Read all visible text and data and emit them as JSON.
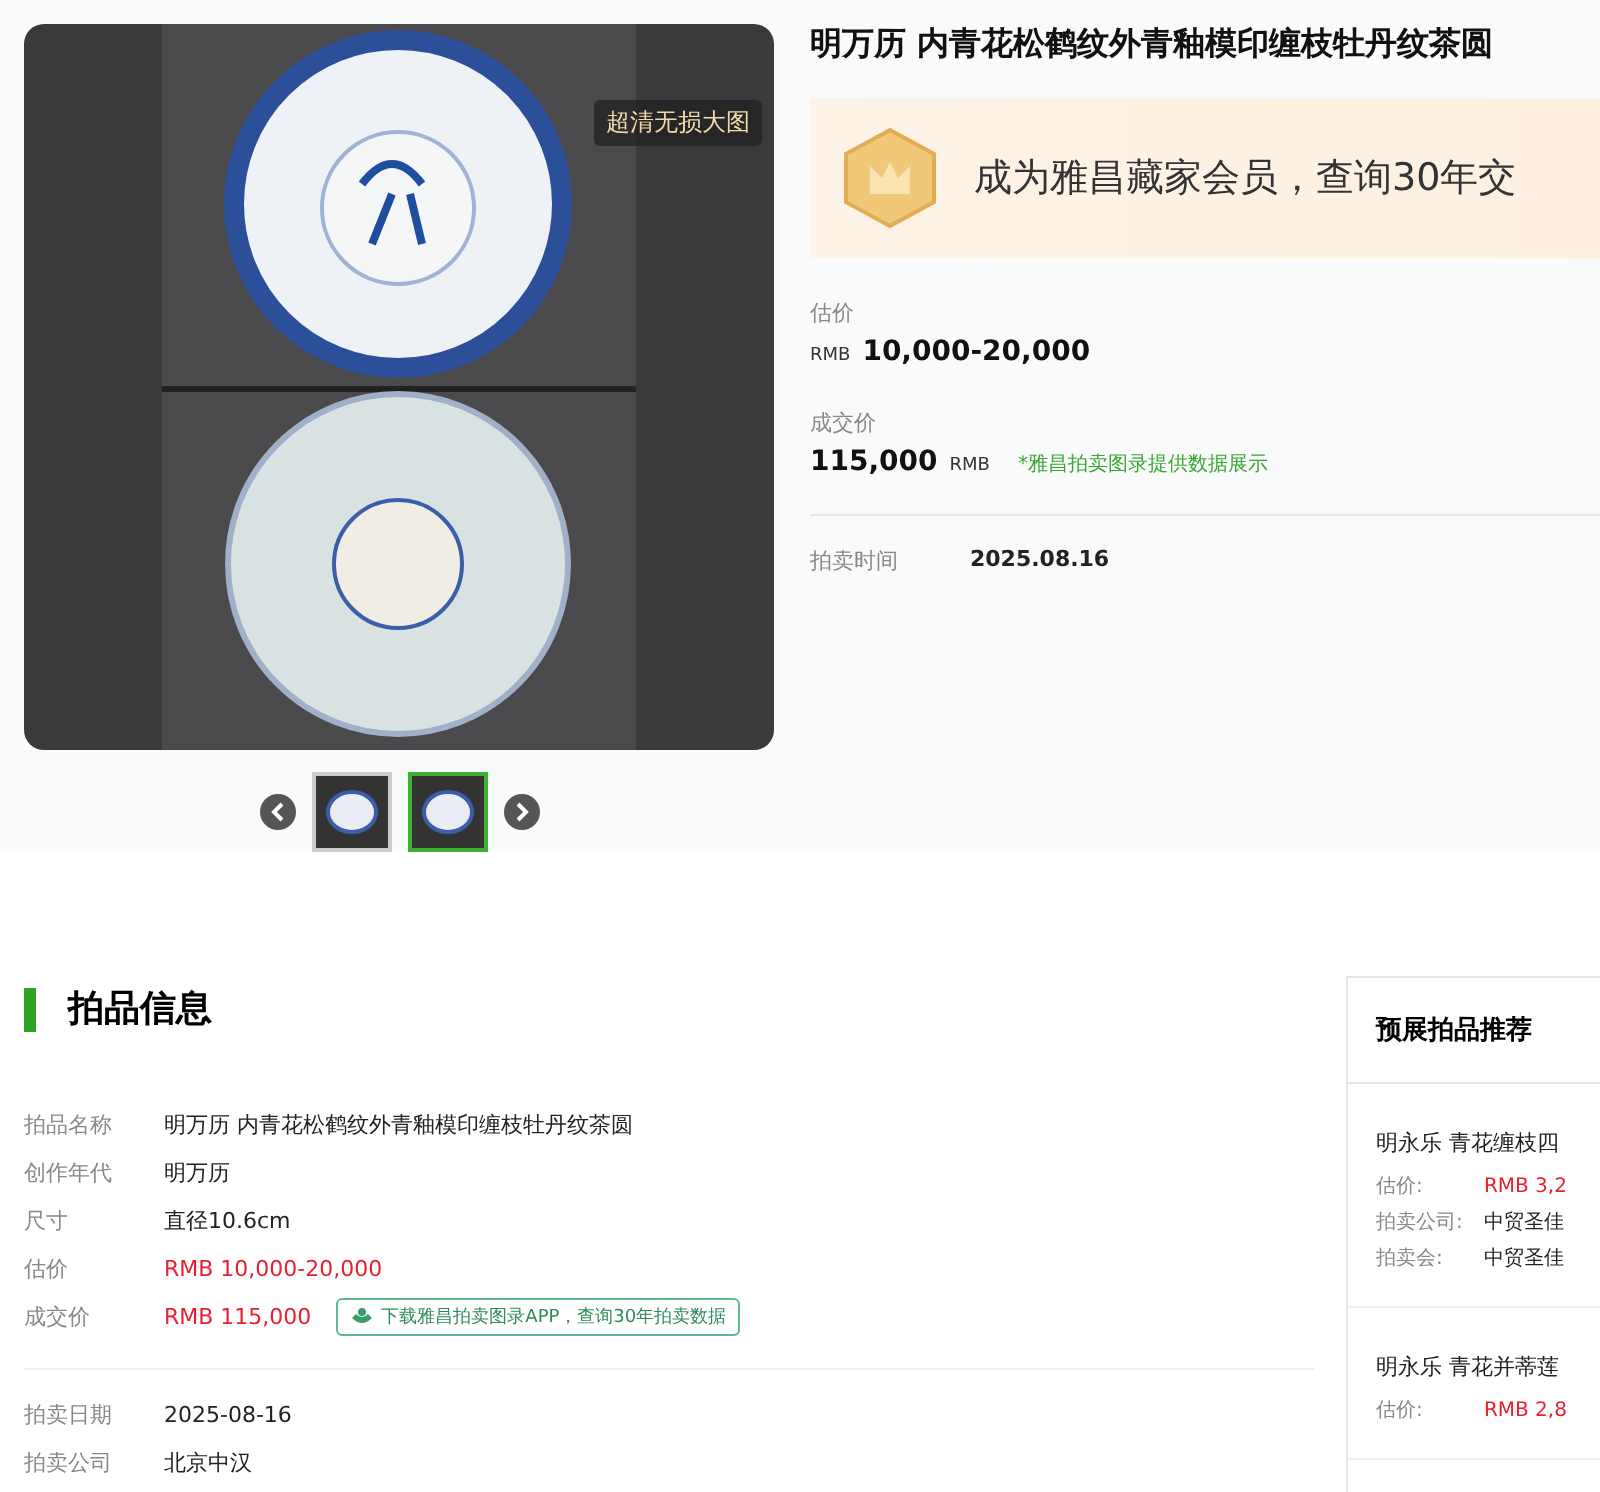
{
  "gallery": {
    "badge": "超清无损大图",
    "thumbnails": [
      {
        "selected": false
      },
      {
        "selected": true
      }
    ]
  },
  "lot": {
    "title": "明万历 内青花松鹤纹外青釉模印缠枝牡丹纹茶圆",
    "banner": "成为雅昌藏家会员，查询30年交",
    "estimate": {
      "label": "估价",
      "currency": "RMB",
      "value": "10,000-20,000"
    },
    "hammer": {
      "label": "成交价",
      "value": "115,000",
      "currency": "RMB",
      "note": "*雅昌拍卖图录提供数据展示"
    },
    "auction_time": {
      "label": "拍卖时间",
      "value": "2025.08.16"
    }
  },
  "info": {
    "title": "拍品信息",
    "groups": [
      [
        {
          "label": "拍品名称",
          "value": "明万历 内青花松鹤纹外青釉模印缠枝牡丹纹茶圆",
          "kind": "plain"
        },
        {
          "label": "创作年代",
          "value": "明万历",
          "kind": "plain"
        },
        {
          "label": "尺寸",
          "value": "直径10.6cm",
          "kind": "plain"
        },
        {
          "label": "估价",
          "value": "RMB 10,000-20,000",
          "kind": "price"
        },
        {
          "label": "成交价",
          "value": "RMB 115,000",
          "kind": "price",
          "promo": "下载雅昌拍卖图录APP，查询30年拍卖数据"
        }
      ],
      [
        {
          "label": "拍卖日期",
          "value": "2025-08-16",
          "kind": "plain"
        },
        {
          "label": "拍卖公司",
          "value": "北京中汉",
          "kind": "plain"
        }
      ]
    ]
  },
  "recommend": {
    "title": "预展拍品推荐",
    "items": [
      {
        "title": "明永乐 青花缠枝四",
        "fields": [
          {
            "label": "估价:",
            "value": "RMB 3,2",
            "kind": "price"
          },
          {
            "label": "拍卖公司:",
            "value": "中贸圣佳",
            "kind": "plain"
          },
          {
            "label": "拍卖会:",
            "value": "中贸圣佳",
            "kind": "plain"
          }
        ]
      },
      {
        "title": "明永乐 青花并蒂莲",
        "fields": [
          {
            "label": "估价:",
            "value": "RMB 2,8",
            "kind": "price"
          }
        ]
      }
    ]
  }
}
